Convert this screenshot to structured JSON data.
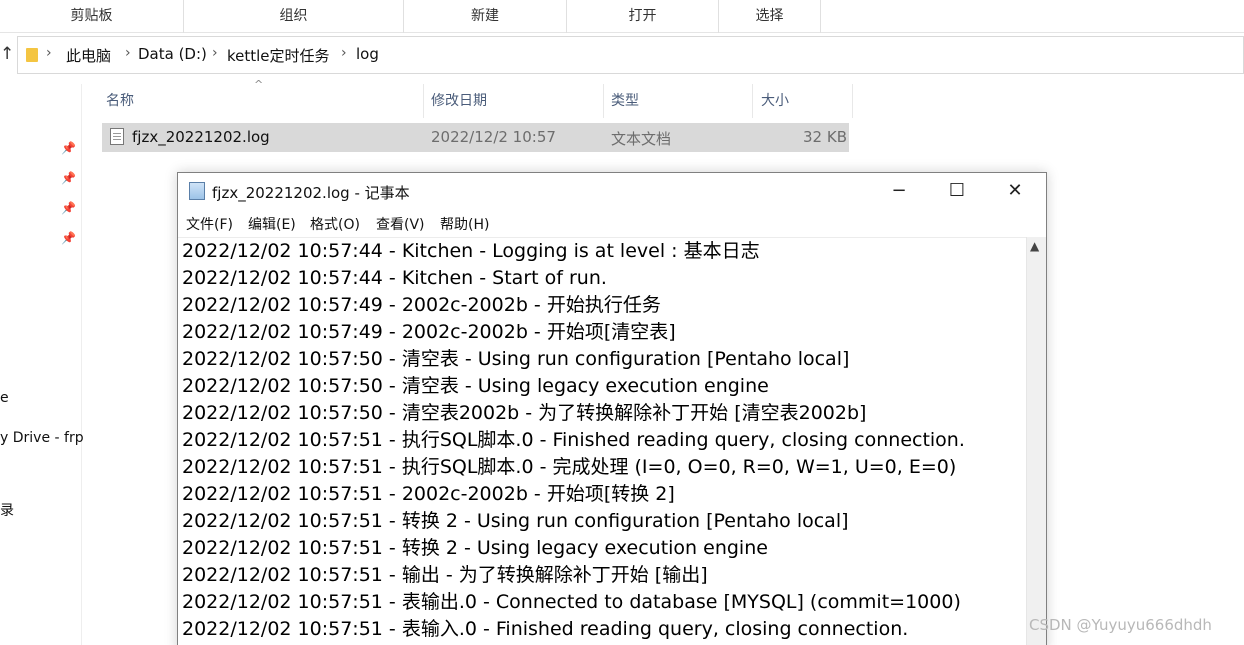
{
  "ribbon": {
    "groups": [
      "剪贴板",
      "组织",
      "新建",
      "打开",
      "选择"
    ]
  },
  "address": {
    "up_icon": "up-arrow-icon",
    "crumbs": [
      "此电脑",
      "Data (D:)",
      "kettle定时任务",
      "log"
    ]
  },
  "nav": {
    "items": [
      "e",
      "y Drive - frp",
      "录"
    ]
  },
  "file_list": {
    "columns": [
      "名称",
      "修改日期",
      "类型",
      "大小"
    ],
    "rows": [
      {
        "name": "fjzx_20221202.log",
        "modified": "2022/12/2 10:57",
        "type": "文本文档",
        "size": "32 KB"
      }
    ]
  },
  "notepad": {
    "title": "fjzx_20221202.log - 记事本",
    "menu": [
      "文件(F)",
      "编辑(E)",
      "格式(O)",
      "查看(V)",
      "帮助(H)"
    ],
    "window_buttons": {
      "minimize": "−",
      "maximize": "☐",
      "close": "✕"
    },
    "lines": [
      "2022/12/02 10:57:44 - Kitchen - Logging is at level : 基本日志",
      "2022/12/02 10:57:44 - Kitchen - Start of run.",
      "2022/12/02 10:57:49 - 2002c-2002b - 开始执行任务",
      "2022/12/02 10:57:49 - 2002c-2002b - 开始项[清空表]",
      "2022/12/02 10:57:50 - 清空表 - Using run configuration [Pentaho local]",
      "2022/12/02 10:57:50 - 清空表 - Using legacy execution engine",
      "2022/12/02 10:57:50 - 清空表2002b - 为了转换解除补丁开始  [清空表2002b]",
      "2022/12/02 10:57:51 - 执行SQL脚本.0 - Finished reading query, closing connection.",
      "2022/12/02 10:57:51 - 执行SQL脚本.0 - 完成处理 (I=0, O=0, R=0, W=1, U=0, E=0)",
      "2022/12/02 10:57:51 - 2002c-2002b - 开始项[转换 2]",
      "2022/12/02 10:57:51 - 转换 2 - Using run configuration [Pentaho local]",
      "2022/12/02 10:57:51 - 转换 2 - Using legacy execution engine",
      "2022/12/02 10:57:51 - 输出 - 为了转换解除补丁开始  [输出]",
      "2022/12/02 10:57:51 - 表输出.0 - Connected to database [MYSQL] (commit=1000)",
      "2022/12/02 10:57:51 - 表输入.0 - Finished reading query, closing connection."
    ]
  },
  "watermark": "CSDN @Yuyuyu666dhdh"
}
